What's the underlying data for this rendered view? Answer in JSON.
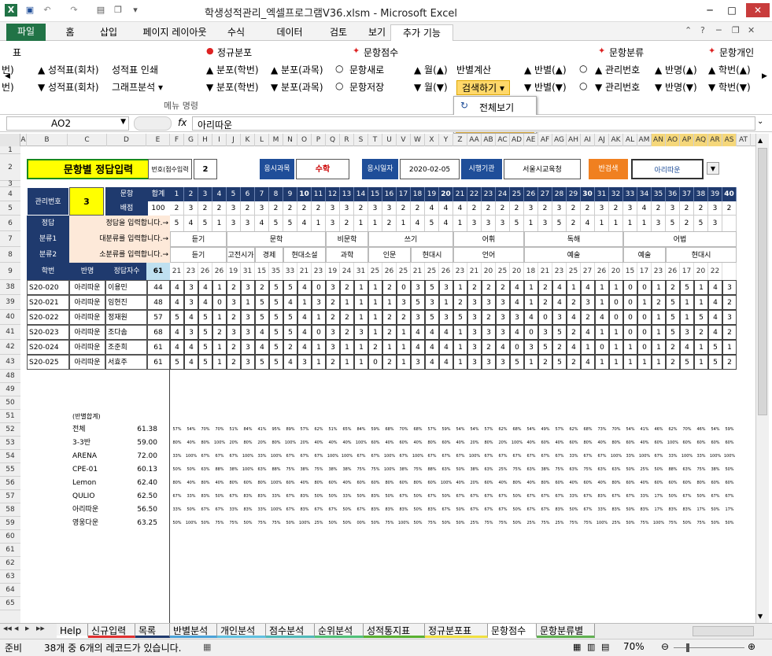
{
  "window": {
    "title": "학생성적관리_엑셀프로그램V36.xlsm  -  Microsoft Excel",
    "min": "─",
    "max": "□",
    "close": "✕"
  },
  "ribbon_tabs": [
    "파일",
    "홈",
    "삽입",
    "페이지 레이아웃",
    "수식",
    "데이터",
    "검토",
    "보기",
    "추가 기능"
  ],
  "ribbon_right_icons": [
    "⌃",
    "?",
    "─",
    "❐",
    "✕"
  ],
  "ribbon": {
    "row0": [
      {
        "t": "표"
      },
      {
        "t": "정규분포",
        "i": "●"
      },
      {
        "t": "문항점수",
        "i": "✦"
      },
      {
        "t": "문항분류",
        "i": "✦"
      },
      {
        "t": "문항개인",
        "i": "✦"
      }
    ],
    "row1": [
      "번)",
      "▲ 성적표(회차)",
      "성적표 인쇄",
      "▲ 분포(학번)",
      "▲ 분포(과목)",
      "○",
      "문항새로",
      "▲ 월(▲)",
      "반별계산",
      "▲ 반별(▲)",
      "○",
      "▲ 관리번호",
      "▲ 반명(▲)",
      "▲ 학번(▲)"
    ],
    "row2": [
      "번)",
      "▼ 성적표(회차)",
      "그래프분석 ▾",
      "▼ 분포(학번)",
      "▼ 분포(과목)",
      "○",
      "문항저장",
      "▼ 월(▼)",
      "검색하기 ▾",
      "▼ 반별(▼)",
      "○",
      "▼ 관리번호",
      "▼ 반명(▼)",
      "▼ 학번(▼)"
    ],
    "group_label": "메뉴 명령"
  },
  "dropdown": {
    "items": [
      "전체보기",
      "반별검색"
    ]
  },
  "namebox": "AO2",
  "formula": "아리따운",
  "fx": "fx",
  "columns": [
    "A",
    "B",
    "C",
    "D",
    "E",
    "F",
    "G",
    "H",
    "I",
    "J",
    "K",
    "L",
    "M",
    "N",
    "O",
    "P",
    "Q",
    "R",
    "S",
    "T",
    "U",
    "V",
    "W",
    "X",
    "Y",
    "Z",
    "AA",
    "AB",
    "AC",
    "AD",
    "AE",
    "AF",
    "AG",
    "AH",
    "AI",
    "AJ",
    "AK",
    "AL",
    "AM",
    "AN",
    "AO",
    "AP",
    "AQ",
    "AR",
    "AS",
    "AT"
  ],
  "row_numbers": [
    "1",
    "2",
    "3",
    "4",
    "5",
    "6",
    "7",
    "8",
    "9",
    "38",
    "39",
    "40",
    "41",
    "42",
    "43",
    "48",
    "49",
    "50",
    "51",
    "52",
    "53",
    "54",
    "55",
    "56",
    "57",
    "58",
    "59",
    "60",
    "61",
    "62",
    "63",
    "64",
    "65"
  ],
  "header": {
    "title": "문항별 정답입력",
    "exam_no_label": "번호(점수입력",
    "exam_no": "2",
    "subject_label": "응시과목",
    "subject": "수학",
    "date_label": "응시일자",
    "date": "2020-02-05",
    "org_label": "시행기관",
    "org": "서울시교육청",
    "class_search_label": "반검색",
    "class_search_value": "아리따운"
  },
  "mgmt": {
    "label": "관리번호",
    "value": "3",
    "q_label": "문항",
    "score_label": "배점",
    "sum_label": "합계",
    "sum_value": "100",
    "answer_label": "정답",
    "answer_hint": "정답을 입력합니다.→",
    "class1_label": "분류1",
    "class1_hint": "대분류를 입력합니다.→",
    "class2_label": "분류2",
    "class2_hint": "소분류를 입력합니다.→",
    "student_label": "학번",
    "class_label": "반명",
    "correct_label": "정답자수",
    "correct_total": "61"
  },
  "questions": [
    "1",
    "2",
    "3",
    "4",
    "5",
    "6",
    "7",
    "8",
    "9",
    "10",
    "11",
    "12",
    "13",
    "14",
    "15",
    "16",
    "17",
    "18",
    "19",
    "20",
    "21",
    "22",
    "23",
    "24",
    "25",
    "26",
    "27",
    "28",
    "29",
    "30",
    "31",
    "32",
    "33",
    "34",
    "35",
    "36",
    "37",
    "38",
    "39",
    "40"
  ],
  "scores": [
    "2",
    "3",
    "2",
    "2",
    "3",
    "2",
    "3",
    "2",
    "2",
    "2",
    "2",
    "3",
    "3",
    "2",
    "3",
    "3",
    "2",
    "2",
    "4",
    "4",
    "4",
    "2",
    "2",
    "2",
    "2",
    "3",
    "2",
    "3",
    "2",
    "2",
    "3",
    "2",
    "3",
    "4",
    "2",
    "3",
    "2",
    "2",
    "3",
    "2"
  ],
  "answers": [
    "5",
    "4",
    "5",
    "1",
    "3",
    "3",
    "4",
    "5",
    "5",
    "4",
    "1",
    "3",
    "2",
    "1",
    "1",
    "2",
    "1",
    "4",
    "5",
    "4",
    "1",
    "3",
    "3",
    "3",
    "5",
    "1",
    "3",
    "5",
    "2",
    "4",
    "1",
    "1",
    "1",
    "1",
    "3",
    "5",
    "2",
    "5",
    "3",
    ""
  ],
  "class1": [
    {
      "t": "듣기",
      "s": 0,
      "n": 4
    },
    {
      "t": "문학",
      "s": 4,
      "n": 7
    },
    {
      "t": "비문학",
      "s": 11,
      "n": 3
    },
    {
      "t": "쓰기",
      "s": 14,
      "n": 6
    },
    {
      "t": "어휘",
      "s": 20,
      "n": 5
    },
    {
      "t": "독해",
      "s": 25,
      "n": 7
    },
    {
      "t": "어법",
      "s": 32,
      "n": 8
    }
  ],
  "class2": [
    {
      "t": "듣기",
      "s": 0,
      "n": 4
    },
    {
      "t": "고전시가",
      "s": 4,
      "n": 2
    },
    {
      "t": "경제",
      "s": 6,
      "n": 2
    },
    {
      "t": "현대소설",
      "s": 8,
      "n": 3
    },
    {
      "t": "과학",
      "s": 11,
      "n": 3
    },
    {
      "t": "인문",
      "s": 14,
      "n": 3
    },
    {
      "t": "현대시",
      "s": 17,
      "n": 3
    },
    {
      "t": "언어",
      "s": 20,
      "n": 5
    },
    {
      "t": "예술",
      "s": 25,
      "n": 7
    },
    {
      "t": "예술",
      "s": 32,
      "n": 3
    },
    {
      "t": "현대시",
      "s": 35,
      "n": 5
    }
  ],
  "correct_counts": [
    "21",
    "23",
    "26",
    "26",
    "19",
    "31",
    "15",
    "35",
    "33",
    "21",
    "23",
    "19",
    "24",
    "31",
    "25",
    "26",
    "25",
    "21",
    "25",
    "26",
    "23",
    "21",
    "20",
    "25",
    "20",
    "18",
    "21",
    "23",
    "25",
    "27",
    "26",
    "20",
    "15",
    "17",
    "23",
    "26",
    "17",
    "20",
    "22",
    ""
  ],
  "students": [
    {
      "id": "S20-020",
      "class": "아리따운",
      "name": "이용민",
      "total": "44",
      "ans": [
        "4",
        "3",
        "4",
        "1",
        "2",
        "3",
        "2",
        "5",
        "5",
        "4",
        "0",
        "3",
        "2",
        "1",
        "1",
        "2",
        "0",
        "3",
        "5",
        "3",
        "1",
        "2",
        "2",
        "2",
        "4",
        "1",
        "2",
        "4",
        "1",
        "4",
        "1",
        "1",
        "0",
        "0",
        "1",
        "2",
        "5",
        "1",
        "4",
        "3"
      ]
    },
    {
      "id": "S20-021",
      "class": "아리따운",
      "name": "임현진",
      "total": "48",
      "ans": [
        "4",
        "3",
        "4",
        "0",
        "3",
        "1",
        "5",
        "5",
        "4",
        "1",
        "3",
        "2",
        "1",
        "1",
        "1",
        "1",
        "3",
        "5",
        "3",
        "1",
        "2",
        "3",
        "3",
        "3",
        "4",
        "1",
        "2",
        "4",
        "2",
        "3",
        "1",
        "0",
        "0",
        "1",
        "2",
        "5",
        "1",
        "1",
        "4",
        "2"
      ]
    },
    {
      "id": "S20-022",
      "class": "아리따운",
      "name": "정재원",
      "total": "57",
      "ans": [
        "5",
        "4",
        "5",
        "1",
        "2",
        "3",
        "5",
        "5",
        "5",
        "4",
        "1",
        "2",
        "2",
        "1",
        "1",
        "2",
        "2",
        "3",
        "5",
        "3",
        "5",
        "3",
        "2",
        "3",
        "3",
        "4",
        "0",
        "3",
        "4",
        "2",
        "4",
        "0",
        "0",
        "0",
        "1",
        "5",
        "1",
        "5",
        "4",
        "3"
      ]
    },
    {
      "id": "S20-023",
      "class": "아리따운",
      "name": "조다솜",
      "total": "68",
      "ans": [
        "4",
        "3",
        "5",
        "2",
        "3",
        "3",
        "4",
        "5",
        "5",
        "4",
        "0",
        "3",
        "2",
        "3",
        "1",
        "2",
        "1",
        "4",
        "4",
        "4",
        "1",
        "3",
        "3",
        "3",
        "4",
        "0",
        "3",
        "5",
        "2",
        "4",
        "1",
        "1",
        "0",
        "0",
        "1",
        "5",
        "3",
        "2",
        "4",
        "2"
      ]
    },
    {
      "id": "S20-024",
      "class": "아리따운",
      "name": "조준희",
      "total": "61",
      "ans": [
        "4",
        "4",
        "5",
        "1",
        "2",
        "3",
        "4",
        "5",
        "2",
        "4",
        "1",
        "3",
        "1",
        "1",
        "2",
        "1",
        "1",
        "4",
        "4",
        "4",
        "1",
        "3",
        "2",
        "4",
        "0",
        "3",
        "5",
        "2",
        "4",
        "1",
        "0",
        "1",
        "1",
        "0",
        "1",
        "2",
        "4",
        "1",
        "5",
        "1"
      ]
    },
    {
      "id": "S20-025",
      "class": "아리따운",
      "name": "서효주",
      "total": "61",
      "ans": [
        "5",
        "4",
        "5",
        "1",
        "2",
        "3",
        "5",
        "5",
        "4",
        "3",
        "1",
        "2",
        "1",
        "1",
        "0",
        "2",
        "1",
        "3",
        "4",
        "4",
        "1",
        "3",
        "3",
        "3",
        "5",
        "1",
        "2",
        "5",
        "2",
        "4",
        "1",
        "1",
        "1",
        "1",
        "1",
        "2",
        "5",
        "1",
        "5",
        "2"
      ]
    }
  ],
  "class_summary": {
    "label": "(반별합계)",
    "rows": [
      {
        "name": "전체",
        "avg": "61.38",
        "p": [
          "57%",
          "54%",
          "70%",
          "70%",
          "51%",
          "84%",
          "41%",
          "95%",
          "89%",
          "57%",
          "62%",
          "51%",
          "65%",
          "84%",
          "59%",
          "68%",
          "70%",
          "68%",
          "57%",
          "59%",
          "54%",
          "54%",
          "57%",
          "62%",
          "68%",
          "54%",
          "49%",
          "57%",
          "62%",
          "68%",
          "73%",
          "70%",
          "54%",
          "41%",
          "46%",
          "62%",
          "70%",
          "46%",
          "54%",
          "59%"
        ]
      },
      {
        "name": "3-3반",
        "avg": "59.00",
        "p": [
          "80%",
          "40%",
          "80%",
          "100%",
          "20%",
          "80%",
          "20%",
          "80%",
          "100%",
          "20%",
          "40%",
          "40%",
          "40%",
          "100%",
          "60%",
          "40%",
          "60%",
          "40%",
          "80%",
          "60%",
          "40%",
          "20%",
          "80%",
          "20%",
          "100%",
          "40%",
          "60%",
          "40%",
          "60%",
          "80%",
          "40%",
          "80%",
          "60%",
          "40%",
          "60%",
          "100%",
          "60%",
          "60%",
          "60%",
          "60%"
        ]
      },
      {
        "name": "ARENA",
        "avg": "72.00",
        "p": [
          "33%",
          "100%",
          "67%",
          "67%",
          "67%",
          "100%",
          "33%",
          "100%",
          "67%",
          "67%",
          "67%",
          "100%",
          "100%",
          "67%",
          "67%",
          "100%",
          "67%",
          "100%",
          "67%",
          "67%",
          "67%",
          "100%",
          "67%",
          "67%",
          "67%",
          "67%",
          "67%",
          "67%",
          "33%",
          "67%",
          "67%",
          "100%",
          "33%",
          "100%",
          "67%",
          "33%",
          "100%",
          "33%",
          "100%",
          "100%"
        ]
      },
      {
        "name": "CPE-01",
        "avg": "60.13",
        "p": [
          "50%",
          "50%",
          "63%",
          "88%",
          "38%",
          "100%",
          "63%",
          "88%",
          "75%",
          "38%",
          "75%",
          "38%",
          "38%",
          "75%",
          "75%",
          "100%",
          "38%",
          "75%",
          "88%",
          "63%",
          "50%",
          "38%",
          "63%",
          "25%",
          "75%",
          "63%",
          "38%",
          "75%",
          "63%",
          "75%",
          "63%",
          "63%",
          "50%",
          "25%",
          "50%",
          "88%",
          "63%",
          "75%",
          "38%",
          "50%"
        ]
      },
      {
        "name": "Lemon",
        "avg": "62.40",
        "p": [
          "80%",
          "40%",
          "80%",
          "40%",
          "80%",
          "60%",
          "80%",
          "100%",
          "60%",
          "40%",
          "80%",
          "60%",
          "40%",
          "60%",
          "60%",
          "80%",
          "60%",
          "80%",
          "60%",
          "100%",
          "40%",
          "20%",
          "60%",
          "40%",
          "80%",
          "40%",
          "80%",
          "60%",
          "40%",
          "60%",
          "40%",
          "80%",
          "60%",
          "40%",
          "60%",
          "60%",
          "60%",
          "80%",
          "60%",
          "60%"
        ]
      },
      {
        "name": "QULIO",
        "avg": "62.50",
        "p": [
          "67%",
          "33%",
          "83%",
          "50%",
          "67%",
          "83%",
          "83%",
          "33%",
          "67%",
          "83%",
          "50%",
          "50%",
          "33%",
          "50%",
          "83%",
          "50%",
          "67%",
          "50%",
          "67%",
          "50%",
          "67%",
          "67%",
          "67%",
          "67%",
          "50%",
          "67%",
          "67%",
          "67%",
          "33%",
          "67%",
          "83%",
          "67%",
          "67%",
          "33%",
          "17%",
          "50%",
          "67%",
          "50%",
          "67%",
          "67%"
        ]
      },
      {
        "name": "아리따운",
        "avg": "56.50",
        "p": [
          "33%",
          "50%",
          "67%",
          "67%",
          "33%",
          "83%",
          "33%",
          "100%",
          "67%",
          "83%",
          "67%",
          "67%",
          "50%",
          "67%",
          "83%",
          "83%",
          "83%",
          "50%",
          "83%",
          "67%",
          "50%",
          "67%",
          "67%",
          "67%",
          "50%",
          "67%",
          "67%",
          "83%",
          "50%",
          "67%",
          "33%",
          "83%",
          "50%",
          "83%",
          "17%",
          "83%",
          "83%",
          "17%",
          "50%",
          "17%"
        ]
      },
      {
        "name": "영웅다운",
        "avg": "63.25",
        "p": [
          "50%",
          "100%",
          "50%",
          "75%",
          "75%",
          "50%",
          "75%",
          "75%",
          "50%",
          "100%",
          "25%",
          "50%",
          "50%",
          "00%",
          "50%",
          "75%",
          "100%",
          "50%",
          "75%",
          "50%",
          "50%",
          "25%",
          "75%",
          "75%",
          "50%",
          "25%",
          "75%",
          "25%",
          "75%",
          "75%",
          "100%",
          "25%",
          "50%",
          "75%",
          "100%",
          "75%",
          "50%",
          "75%",
          "50%",
          "50%"
        ]
      }
    ]
  },
  "sheet_tabs": [
    {
      "t": "Help",
      "c": "#fff"
    },
    {
      "t": "신규입력",
      "c": "#e03030"
    },
    {
      "t": "목록",
      "c": "#1f3a6e"
    },
    {
      "t": "반별분석",
      "c": "#4aa2d8"
    },
    {
      "t": "개인분석",
      "c": "#5fc0e0"
    },
    {
      "t": "점수분석",
      "c": "#4fb8b8"
    },
    {
      "t": "순위분석",
      "c": "#4fc078"
    },
    {
      "t": "성적통지표",
      "c": "#59b030"
    },
    {
      "t": "정규분포표",
      "c": "#f0e040"
    },
    {
      "t": "문항점수",
      "c": "#ffffff",
      "active": true
    },
    {
      "t": "문항분류별",
      "c": "#60b050"
    }
  ],
  "status": {
    "mode": "준비",
    "text": "38개 중 6개의 레코드가 있습니다.",
    "zoom": "70%"
  }
}
